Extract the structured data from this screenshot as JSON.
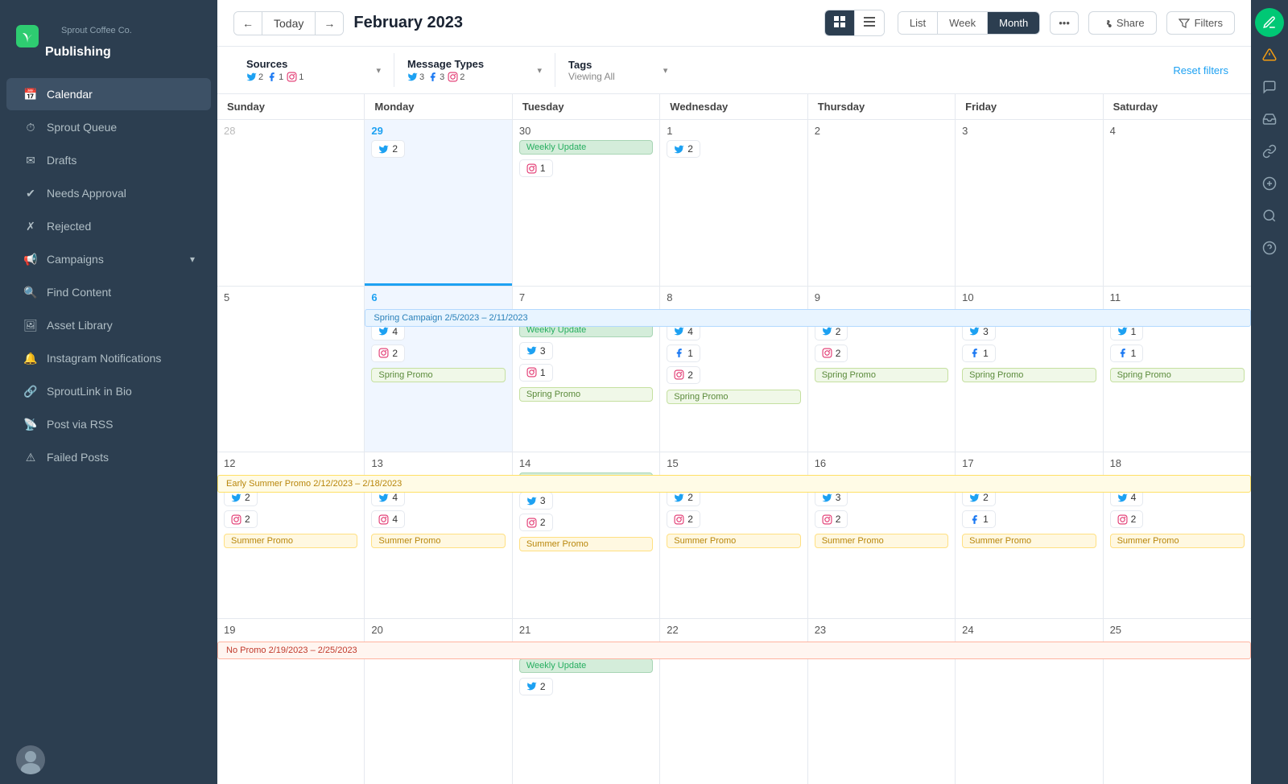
{
  "brand": {
    "company": "Sprout Coffee Co.",
    "app": "Publishing"
  },
  "sidebar": {
    "items": [
      {
        "id": "calendar",
        "label": "Calendar",
        "active": true
      },
      {
        "id": "sprout-queue",
        "label": "Sprout Queue",
        "active": false
      },
      {
        "id": "drafts",
        "label": "Drafts",
        "active": false
      },
      {
        "id": "needs-approval",
        "label": "Needs Approval",
        "active": false
      },
      {
        "id": "rejected",
        "label": "Rejected",
        "active": false
      },
      {
        "id": "campaigns",
        "label": "Campaigns",
        "active": false,
        "hasChevron": true
      },
      {
        "id": "find-content",
        "label": "Find Content",
        "active": false
      },
      {
        "id": "asset-library",
        "label": "Asset Library",
        "active": false
      },
      {
        "id": "instagram-notifications",
        "label": "Instagram Notifications",
        "active": false
      },
      {
        "id": "sproutlink-in-bio",
        "label": "SproutLink in Bio",
        "active": false
      },
      {
        "id": "post-via-rss",
        "label": "Post via RSS",
        "active": false
      },
      {
        "id": "failed-posts",
        "label": "Failed Posts",
        "active": false
      }
    ]
  },
  "toolbar": {
    "today_label": "Today",
    "month_title": "February 2023",
    "view_list": "List",
    "view_week": "Week",
    "view_month": "Month",
    "share_label": "Share",
    "filters_label": "Filters"
  },
  "filters": {
    "sources_label": "Sources",
    "sources_tw": "2",
    "sources_fb": "1",
    "sources_ig": "1",
    "message_types_label": "Message Types",
    "message_types_tw": "3",
    "message_types_fb": "3",
    "message_types_ig": "2",
    "tags_label": "Tags",
    "tags_viewing": "Viewing All",
    "reset_label": "Reset filters"
  },
  "calendar": {
    "days": [
      "Sunday",
      "Monday",
      "Tuesday",
      "Wednesday",
      "Thursday",
      "Friday",
      "Saturday"
    ],
    "weekly_update": "Weekly Update",
    "campaigns": {
      "spring": "Spring Campaign 2/5/2023 – 2/11/2023",
      "early_summer": "Early Summer Promo 2/12/2023 – 2/18/2023",
      "no_promo": "No Promo 2/19/2023 – 2/25/2023"
    },
    "promos": {
      "spring": "Spring Promo",
      "summer": "Summer Promo"
    }
  }
}
